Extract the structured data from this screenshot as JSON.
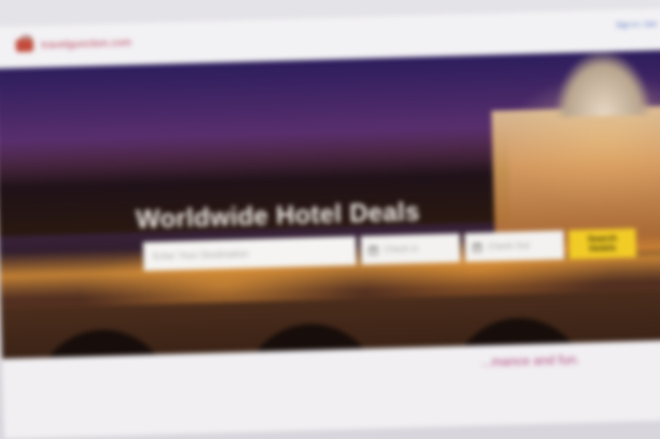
{
  "site": {
    "logo_text": "travelgunction.com",
    "header_right_top": "",
    "header_right_link": "Sign in / Join"
  },
  "hero": {
    "title": "Worldwide Hotel Deals",
    "destination_placeholder": "Enter Your Destination",
    "checkin_placeholder": "Check in",
    "checkout_placeholder": "Check Out",
    "search_label": "Search Hotels"
  },
  "below": {
    "tagline": "...mance and fun."
  },
  "colors": {
    "accent_button": "#f2cc26",
    "logo": "#c24b3c",
    "link": "#4a6fbf"
  }
}
